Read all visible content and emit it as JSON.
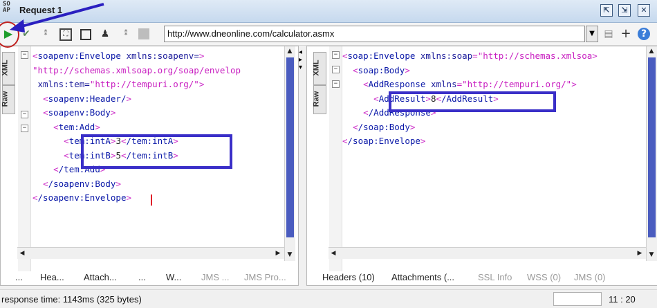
{
  "window": {
    "title": "Request 1",
    "logo": "SO\nAP"
  },
  "toolbar": {
    "url": "http://www.dneonline.com/calculator.asmx",
    "add_label": "+",
    "help_label": "?"
  },
  "left_panel": {
    "tabs": [
      "XML",
      "Raw"
    ],
    "lines": [
      {
        "indent": 0,
        "open": "soapenv:Envelope",
        "attr": "xmlns:soapenv",
        "eq": "="
      },
      {
        "indent": 0,
        "val": "\"http://schemas.xmlsoap.org/soap/envelop"
      },
      {
        "indent": 1,
        "attr": "xmlns:tem",
        "val": "\"http://tempuri.org/\"",
        "end": ">"
      },
      {
        "indent": 2,
        "self": "soapenv:Header/"
      },
      {
        "indent": 2,
        "open": "soapenv:Body"
      },
      {
        "indent": 4,
        "open": "tem:Add"
      },
      {
        "indent": 6,
        "open": "tem:intA",
        "text": "3",
        "close": "/tem:intA"
      },
      {
        "indent": 6,
        "open": "tem:intB",
        "text": "5",
        "close": "/tem:intB"
      },
      {
        "indent": 4,
        "close": "/tem:Add"
      },
      {
        "indent": 2,
        "close": "/soapenv:Body"
      },
      {
        "indent": 0,
        "close": "/soapenv:Envelope"
      }
    ]
  },
  "right_panel": {
    "tabs": [
      "XML",
      "Raw"
    ],
    "lines": [
      {
        "indent": 0,
        "open": "soap:Envelope",
        "attr": "xmlns:soap",
        "val": "=\"http://schemas.xmlsoa"
      },
      {
        "indent": 2,
        "open": "soap:Body"
      },
      {
        "indent": 4,
        "open": "AddResponse",
        "attr": "xmlns",
        "val": "=\"http://tempuri.org/\"",
        "end": ">"
      },
      {
        "indent": 6,
        "open": "AddResult",
        "text": "8",
        "close": "/AddResult"
      },
      {
        "indent": 4,
        "close": "/AddResponse"
      },
      {
        "indent": 2,
        "close": "/soap:Body"
      },
      {
        "indent": 0,
        "close": "/soap:Envelope"
      }
    ]
  },
  "left_bottom_tabs": [
    {
      "label": "...",
      "enabled": true
    },
    {
      "label": "Hea...",
      "enabled": true
    },
    {
      "label": "Attach...",
      "enabled": true
    },
    {
      "label": "...",
      "enabled": true
    },
    {
      "label": "W...",
      "enabled": true
    },
    {
      "label": "JMS ...",
      "enabled": false
    },
    {
      "label": "JMS Pro...",
      "enabled": false
    }
  ],
  "right_bottom_tabs": [
    {
      "label": "Headers (10)",
      "enabled": true
    },
    {
      "label": "Attachments (...",
      "enabled": true
    },
    {
      "label": "SSL Info",
      "enabled": false
    },
    {
      "label": "WSS (0)",
      "enabled": false
    },
    {
      "label": "JMS (0)",
      "enabled": false
    }
  ],
  "status": {
    "response": "response time: 1143ms (325 bytes)",
    "caret": "11 : 20"
  },
  "colors": {
    "tag": "#0a18a8",
    "bracket": "#cc2ec8",
    "highlight": "#3a2fc8",
    "annotation_circle": "#c0201e",
    "annotation_arrow": "#2a1fc0"
  }
}
